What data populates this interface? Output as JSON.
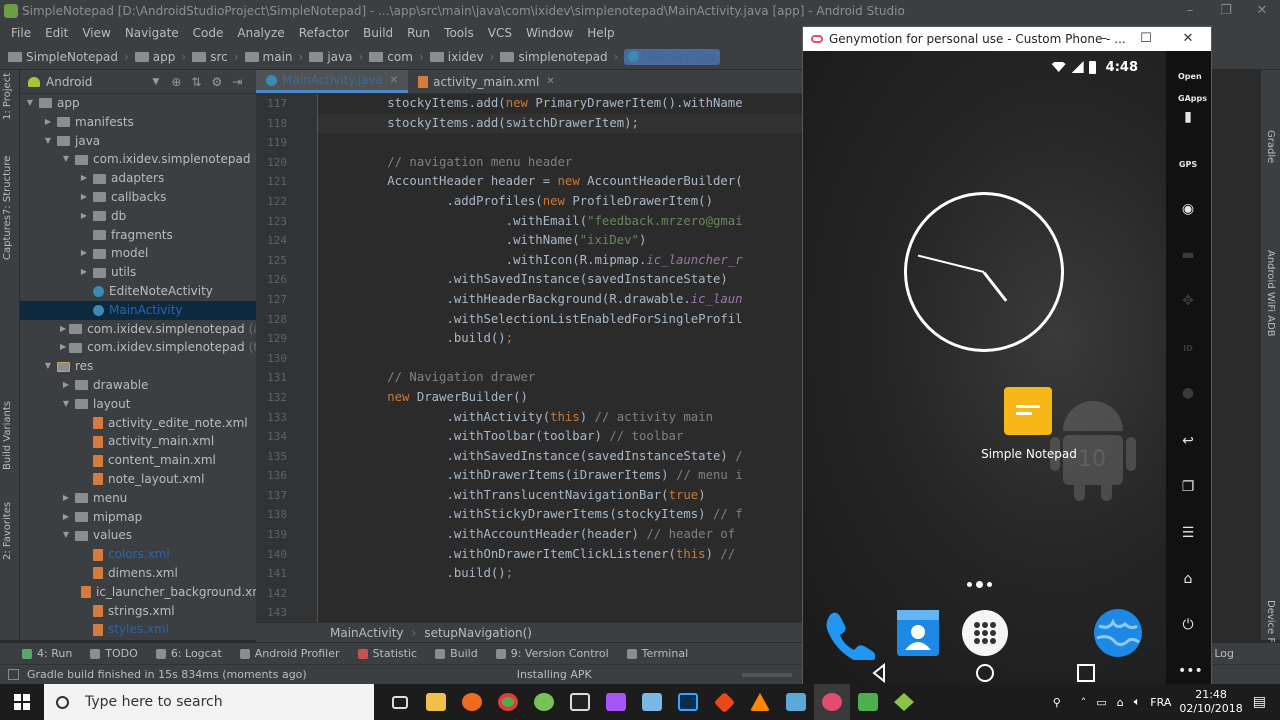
{
  "window": {
    "title": "SimpleNotepad [D:\\AndroidStudioProject\\SimpleNotepad] - ...\\app\\src\\main\\java\\com\\ixidev\\simplenotepad\\MainActivity.java [app] - Android Studio"
  },
  "menu": [
    "File",
    "Edit",
    "View",
    "Navigate",
    "Code",
    "Analyze",
    "Refactor",
    "Build",
    "Run",
    "Tools",
    "VCS",
    "Window",
    "Help"
  ],
  "breadcrumbs": [
    "SimpleNotepad",
    "app",
    "src",
    "main",
    "java",
    "com",
    "ixidev",
    "simplenotepad",
    "MainActivity"
  ],
  "project_panel": {
    "view_selector": "Android",
    "tree": [
      {
        "label": "app",
        "depth": 0,
        "arrow": "▼",
        "icon": "folder"
      },
      {
        "label": "manifests",
        "depth": 1,
        "arrow": "▶",
        "icon": "folder"
      },
      {
        "label": "java",
        "depth": 1,
        "arrow": "▼",
        "icon": "folder"
      },
      {
        "label": "com.ixidev.simplenotepad",
        "depth": 2,
        "arrow": "▼",
        "icon": "pkg"
      },
      {
        "label": "adapters",
        "depth": 3,
        "arrow": "▶",
        "icon": "pkg"
      },
      {
        "label": "callbacks",
        "depth": 3,
        "arrow": "▶",
        "icon": "pkg"
      },
      {
        "label": "db",
        "depth": 3,
        "arrow": "▶",
        "icon": "pkg"
      },
      {
        "label": "fragments",
        "depth": 3,
        "arrow": "",
        "icon": "pkg"
      },
      {
        "label": "model",
        "depth": 3,
        "arrow": "▶",
        "icon": "pkg"
      },
      {
        "label": "utils",
        "depth": 3,
        "arrow": "▶",
        "icon": "pkg"
      },
      {
        "label": "EditeNoteActivity",
        "depth": 3,
        "arrow": "",
        "icon": "cls"
      },
      {
        "label": "MainActivity",
        "depth": 3,
        "arrow": "",
        "icon": "cls",
        "selected": true
      },
      {
        "label": "com.ixidev.simplenotepad",
        "suffix": "(andr",
        "depth": 2,
        "arrow": "▶",
        "icon": "pkg"
      },
      {
        "label": "com.ixidev.simplenotepad",
        "suffix": "(test",
        "depth": 2,
        "arrow": "▶",
        "icon": "pkg"
      },
      {
        "label": "res",
        "depth": 1,
        "arrow": "▼",
        "icon": "res"
      },
      {
        "label": "drawable",
        "depth": 2,
        "arrow": "▶",
        "icon": "folder"
      },
      {
        "label": "layout",
        "depth": 2,
        "arrow": "▼",
        "icon": "folder"
      },
      {
        "label": "activity_edite_note.xml",
        "depth": 3,
        "arrow": "",
        "icon": "xml"
      },
      {
        "label": "activity_main.xml",
        "depth": 3,
        "arrow": "",
        "icon": "xml"
      },
      {
        "label": "content_main.xml",
        "depth": 3,
        "arrow": "",
        "icon": "xml"
      },
      {
        "label": "note_layout.xml",
        "depth": 3,
        "arrow": "",
        "icon": "xml"
      },
      {
        "label": "menu",
        "depth": 2,
        "arrow": "▶",
        "icon": "folder"
      },
      {
        "label": "mipmap",
        "depth": 2,
        "arrow": "▶",
        "icon": "folder"
      },
      {
        "label": "values",
        "depth": 2,
        "arrow": "▼",
        "icon": "folder"
      },
      {
        "label": "colors.xml",
        "depth": 3,
        "arrow": "",
        "icon": "xml",
        "blue": true
      },
      {
        "label": "dimens.xml",
        "depth": 3,
        "arrow": "",
        "icon": "xml"
      },
      {
        "label": "ic_launcher_background.xml",
        "depth": 3,
        "arrow": "",
        "icon": "xml"
      },
      {
        "label": "strings.xml",
        "depth": 3,
        "arrow": "",
        "icon": "xml"
      },
      {
        "label": "styles.xml",
        "depth": 3,
        "arrow": "",
        "icon": "xml",
        "blue": true
      }
    ]
  },
  "left_tabs": [
    "1: Project",
    "7: Structure",
    "Captures",
    "Build Variants",
    "2: Favorites"
  ],
  "right_tabs": [
    "Gradle",
    "Android WiFi ADB",
    "Device File Explorer"
  ],
  "editor": {
    "tabs": [
      {
        "label": "MainActivity.java",
        "active": true,
        "icon": "cls"
      },
      {
        "label": "activity_main.xml",
        "active": false,
        "icon": "xml"
      }
    ],
    "lines": [
      {
        "n": "117",
        "t": [
          [
            "",
            "        stockyItems.add("
          ],
          [
            "kw",
            "new "
          ],
          [
            "",
            "PrimaryDrawerItem().withName"
          ]
        ]
      },
      {
        "n": "118",
        "hl": true,
        "t": [
          [
            "",
            "        stockyItems.add(switchDrawerItem);"
          ]
        ]
      },
      {
        "n": "119",
        "t": [
          [
            "",
            ""
          ]
        ]
      },
      {
        "n": "120",
        "t": [
          [
            "cmt",
            "        // navigation menu header"
          ]
        ]
      },
      {
        "n": "121",
        "t": [
          [
            "",
            "        AccountHeader header = "
          ],
          [
            "kw",
            "new "
          ],
          [
            "",
            "AccountHeaderBuilder("
          ]
        ]
      },
      {
        "n": "122",
        "t": [
          [
            "",
            "                .addProfiles("
          ],
          [
            "kw",
            "new "
          ],
          [
            "",
            "ProfileDrawerItem()"
          ]
        ]
      },
      {
        "n": "123",
        "t": [
          [
            "",
            "                        .withEmail("
          ],
          [
            "str",
            "\"feedback.mrzero@gmai"
          ]
        ]
      },
      {
        "n": "124",
        "t": [
          [
            "",
            "                        .withName("
          ],
          [
            "str",
            "\"ixiDev\""
          ],
          [
            "",
            ")"
          ]
        ]
      },
      {
        "n": "125",
        "t": [
          [
            "",
            "                        .withIcon(R.mipmap."
          ],
          [
            "it",
            "ic_launcher_r"
          ]
        ]
      },
      {
        "n": "126",
        "t": [
          [
            "",
            "                .withSavedInstance(savedInstanceState)"
          ]
        ]
      },
      {
        "n": "127",
        "t": [
          [
            "",
            "                .withHeaderBackground(R.drawable."
          ],
          [
            "it",
            "ic_laun"
          ]
        ]
      },
      {
        "n": "128",
        "t": [
          [
            "",
            "                .withSelectionListEnabledForSingleProfil"
          ]
        ]
      },
      {
        "n": "129",
        "t": [
          [
            "",
            "                .build()"
          ],
          [
            "kw",
            ";"
          ]
        ]
      },
      {
        "n": "130",
        "t": [
          [
            "",
            ""
          ]
        ]
      },
      {
        "n": "131",
        "t": [
          [
            "cmt",
            "        // Navigation drawer"
          ]
        ]
      },
      {
        "n": "132",
        "t": [
          [
            "kw",
            "        new "
          ],
          [
            "",
            "DrawerBuilder()"
          ]
        ]
      },
      {
        "n": "133",
        "t": [
          [
            "",
            "                .withActivity("
          ],
          [
            "kw",
            "this"
          ],
          [
            "",
            ") "
          ],
          [
            "cmt",
            "// activity main"
          ]
        ]
      },
      {
        "n": "134",
        "t": [
          [
            "",
            "                .withToolbar(toolbar) "
          ],
          [
            "cmt",
            "// toolbar"
          ]
        ]
      },
      {
        "n": "135",
        "t": [
          [
            "",
            "                .withSavedInstance(savedInstanceState) "
          ],
          [
            "cmt",
            "/"
          ]
        ]
      },
      {
        "n": "136",
        "t": [
          [
            "",
            "                .withDrawerItems(iDrawerItems) "
          ],
          [
            "cmt",
            "// menu i"
          ]
        ]
      },
      {
        "n": "137",
        "t": [
          [
            "",
            "                .withTranslucentNavigationBar("
          ],
          [
            "kw",
            "true"
          ],
          [
            "",
            ")"
          ]
        ]
      },
      {
        "n": "138",
        "t": [
          [
            "",
            "                .withStickyDrawerItems(stockyItems) "
          ],
          [
            "cmt",
            "// f"
          ]
        ]
      },
      {
        "n": "139",
        "t": [
          [
            "",
            "                .withAccountHeader(header) "
          ],
          [
            "cmt",
            "// header of"
          ]
        ]
      },
      {
        "n": "140",
        "t": [
          [
            "",
            "                .withOnDrawerItemClickListener("
          ],
          [
            "kw",
            "this"
          ],
          [
            "",
            ") "
          ],
          [
            "cmt",
            "//"
          ]
        ]
      },
      {
        "n": "141",
        "t": [
          [
            "",
            "                .build()"
          ],
          [
            "kw",
            ";"
          ]
        ]
      },
      {
        "n": "142",
        "t": [
          [
            "",
            ""
          ]
        ]
      },
      {
        "n": "143",
        "t": [
          [
            "",
            ""
          ]
        ]
      }
    ],
    "breadcrumb": [
      "MainActivity",
      "setupNavigation()"
    ]
  },
  "bottom_tools": [
    {
      "label": "4: Run",
      "color": "#59a869"
    },
    {
      "label": "TODO",
      "color": "#8a8d91"
    },
    {
      "label": "6: Logcat",
      "color": "#8a8d91"
    },
    {
      "label": "Android Profiler",
      "color": "#8a8d91"
    },
    {
      "label": "Statistic",
      "color": "#c75450"
    },
    {
      "label": "Build",
      "color": "#8a8d91"
    },
    {
      "label": "9: Version Control",
      "color": "#8a8d91"
    },
    {
      "label": "Terminal",
      "color": "#8a8d91"
    }
  ],
  "event_log_label": "Event Log",
  "status": {
    "message": "Gradle build finished in 15s 834ms (moments ago)",
    "task": "Installing APK"
  },
  "emulator": {
    "title": "Genymotion for personal use - Custom Phone - ...",
    "time": "4:48",
    "app_label": "Simple Notepad",
    "side_labels": [
      "Open GApps",
      "GPS",
      "ID"
    ]
  },
  "taskbar": {
    "search_placeholder": "Type here to search",
    "language": "FRA",
    "time": "21:48",
    "date": "02/10/2018"
  }
}
